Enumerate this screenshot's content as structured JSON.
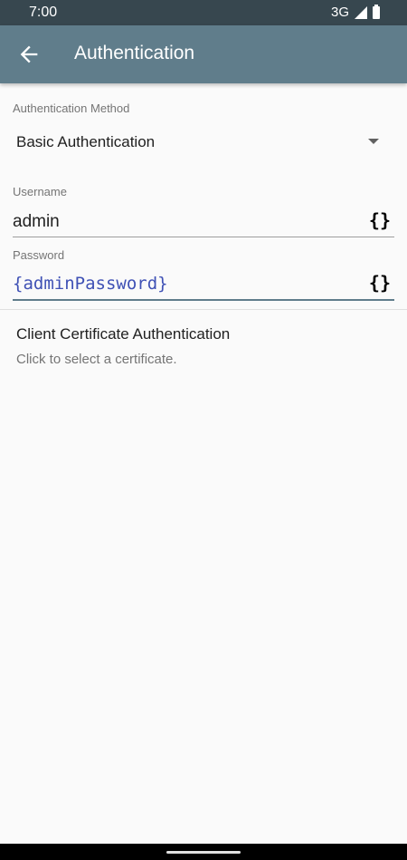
{
  "status_bar": {
    "time": "7:00",
    "network": "3G",
    "icons": [
      "signal-icon",
      "battery-icon"
    ]
  },
  "app_bar": {
    "back_icon": "arrow-back-icon",
    "title": "Authentication"
  },
  "auth_method": {
    "label": "Authentication Method",
    "value": "Basic Authentication"
  },
  "username": {
    "label": "Username",
    "value": "admin",
    "variable_icon": "{}"
  },
  "password": {
    "label": "Password",
    "value": "{adminPassword}",
    "variable_icon": "{}"
  },
  "client_certificate": {
    "title": "Client Certificate Authentication",
    "subtitle": "Click to select a certificate."
  },
  "colors": {
    "status_bar": "#37474f",
    "app_bar": "#607d8b",
    "variable_text": "#3f51b5",
    "background": "#fafafa"
  }
}
